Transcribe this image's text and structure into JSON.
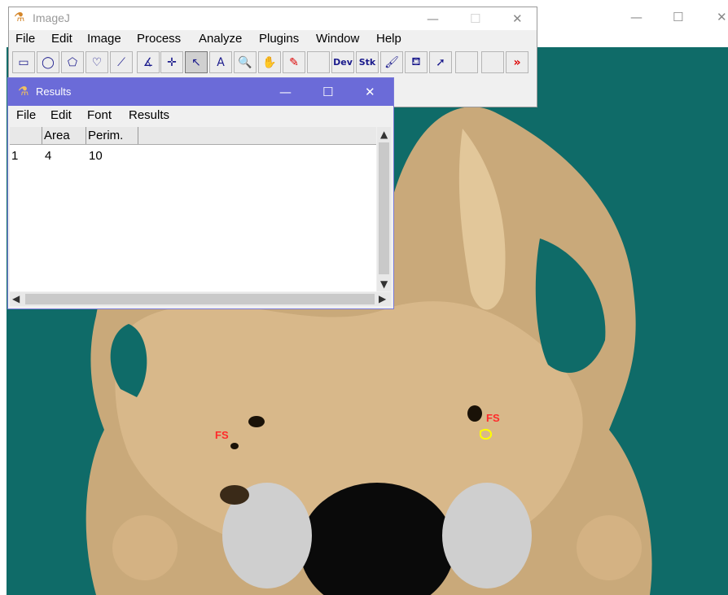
{
  "background_window": {
    "controls": {
      "minimize": "—",
      "maximize": "☐",
      "close": "✕"
    },
    "labels": [
      "FS",
      "FS"
    ]
  },
  "imagej": {
    "title": "ImageJ",
    "menu": [
      "File",
      "Edit",
      "Image",
      "Process",
      "Analyze",
      "Plugins",
      "Window",
      "Help"
    ],
    "controls": {
      "minimize": "—",
      "maximize": "☐",
      "close": "✕"
    },
    "tools": [
      {
        "name": "rectangle-tool-icon",
        "glyph": "▭"
      },
      {
        "name": "oval-tool-icon",
        "glyph": "◯"
      },
      {
        "name": "polygon-tool-icon",
        "glyph": "⬠"
      },
      {
        "name": "freehand-tool-icon",
        "glyph": "♡"
      },
      {
        "name": "line-tool-icon",
        "glyph": "⟋"
      },
      {
        "name": "angle-tool-icon",
        "glyph": "∡"
      },
      {
        "name": "point-tool-icon",
        "glyph": "✛"
      },
      {
        "name": "wand-tool-icon",
        "glyph": "↖"
      },
      {
        "name": "text-tool-icon",
        "glyph": "A"
      },
      {
        "name": "magnifier-tool-icon",
        "glyph": "🔍"
      },
      {
        "name": "scroll-tool-icon",
        "glyph": "✋"
      },
      {
        "name": "color-picker-tool-icon",
        "glyph": "✎"
      },
      {
        "name": "blank-tool-icon",
        "glyph": ""
      },
      {
        "name": "dev-tool-icon",
        "glyph": "Dev"
      },
      {
        "name": "stk-tool-icon",
        "glyph": "Stk"
      },
      {
        "name": "brush-tool-icon",
        "glyph": "🖌"
      },
      {
        "name": "flood-fill-tool-icon",
        "glyph": "⛾"
      },
      {
        "name": "arrow-tool-icon",
        "glyph": "➚"
      },
      {
        "name": "blank-tool-icon",
        "glyph": ""
      },
      {
        "name": "blank-tool-icon",
        "glyph": ""
      },
      {
        "name": "more-tools-icon",
        "glyph": "»"
      }
    ]
  },
  "results": {
    "title": "Results",
    "menu": [
      "File",
      "Edit",
      "Font",
      "Results"
    ],
    "controls": {
      "minimize": "—",
      "maximize": "☐",
      "close": "✕"
    },
    "columns": [
      "",
      "Area",
      "Perim."
    ],
    "rows": [
      [
        "1",
        "4",
        "10"
      ]
    ]
  },
  "colors": {
    "results_title": "#6b6bd8",
    "photo_bg": "#0f6b68",
    "label": "#ff2a2a"
  }
}
